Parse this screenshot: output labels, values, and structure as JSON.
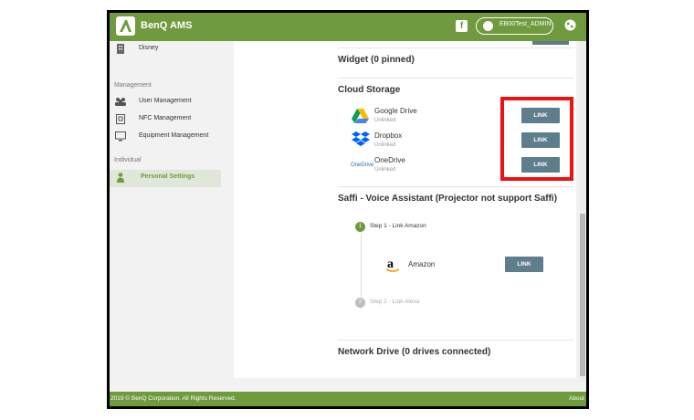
{
  "header": {
    "app_title": "BenQ AMS",
    "user_name": "EB00Test_ADMIN"
  },
  "sidebar": {
    "items": [
      {
        "label": "Disney"
      },
      {
        "label": "User Management"
      },
      {
        "label": "NFC Management"
      },
      {
        "label": "Equipment Management"
      },
      {
        "label": "Personal Settings"
      }
    ],
    "sections": {
      "management": "Management",
      "individual": "Individual"
    }
  },
  "main": {
    "widget_header": "Widget (0 pinned)",
    "cloud_header": "Cloud Storage",
    "cloud_services": [
      {
        "name": "Google Drive",
        "status": "Unlinked",
        "button": "LINK"
      },
      {
        "name": "Dropbox",
        "status": "Unlinked",
        "button": "LINK"
      },
      {
        "name": "OneDrive",
        "status": "Unlinked",
        "button": "LINK",
        "logo_text": "OneDrive"
      }
    ],
    "saffi_header": "Saffi - Voice Assistant (Projector not support Saffi)",
    "steps": [
      {
        "number": "1",
        "label": "Step 1 - Link Amazon"
      },
      {
        "number": "2",
        "label": "Step 2 - Link Alexa"
      }
    ],
    "amazon": {
      "name": "Amazon",
      "button": "LINK"
    },
    "network_header": "Network Drive (0 drives connected)"
  },
  "footer": {
    "copyright": "2019 © BenQ Corporation. All Rights Reserved.",
    "about": "About"
  },
  "colors": {
    "brand_green": "#6f9a3d",
    "button": "#5e7d8d",
    "highlight": "#ee1111"
  }
}
